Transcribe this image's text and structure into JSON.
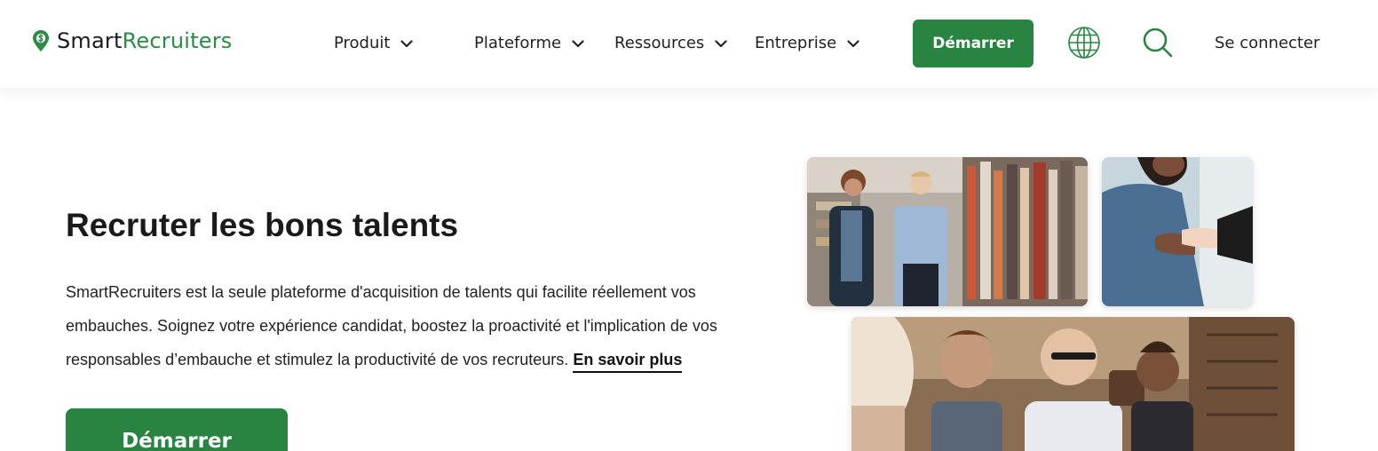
{
  "header": {
    "logo": {
      "part1": "Smart",
      "part2": "Recruiters"
    },
    "nav": [
      {
        "label": "Produit"
      },
      {
        "label": "Plateforme"
      },
      {
        "label": "Ressources"
      },
      {
        "label": "Entreprise"
      }
    ],
    "cta_label": "Démarrer",
    "icons": [
      "globe-icon",
      "search-icon",
      "chevron-down-icon"
    ],
    "login_label": "Se connecter"
  },
  "hero": {
    "title": "Recruter les bons talents",
    "description": "SmartRecruiters est la seule plateforme d'acquisition de talents qui facilite réellement vos embauches. Soignez votre expérience candidat, boostez la proactivité et l'implication de vos responsables d’embauche et stimulez la productivité de vos recruteurs.",
    "link_label": "En savoir plus",
    "cta_label": "Démarrer"
  },
  "colors": {
    "brand_green": "#2a8441",
    "text": "#1a1a1a",
    "background": "#ffffff"
  }
}
